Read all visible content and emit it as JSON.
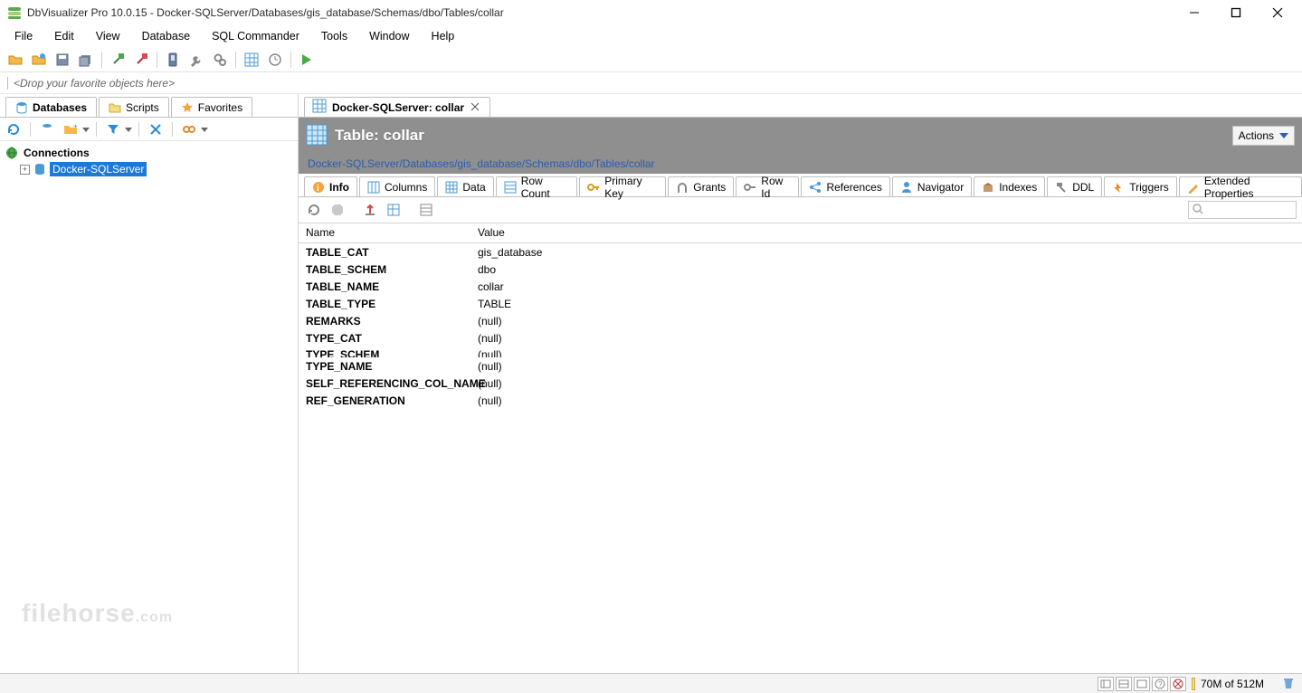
{
  "window": {
    "title": "DbVisualizer Pro 10.0.15 - Docker-SQLServer/Databases/gis_database/Schemas/dbo/Tables/collar"
  },
  "menubar": [
    "File",
    "Edit",
    "View",
    "Database",
    "SQL Commander",
    "Tools",
    "Window",
    "Help"
  ],
  "toolbar_icons": [
    "folder",
    "new-db",
    "save",
    "save-all",
    "connect",
    "disconnect",
    "device",
    "wrench",
    "gears",
    "grid",
    "clock",
    "run"
  ],
  "droparea": "<Drop your favorite objects here>",
  "left": {
    "tabs": [
      {
        "id": "databases",
        "label": "Databases",
        "active": true
      },
      {
        "id": "scripts",
        "label": "Scripts",
        "active": false
      },
      {
        "id": "favorites",
        "label": "Favorites",
        "active": false
      }
    ],
    "tree": {
      "root": "Connections",
      "items": [
        {
          "label": "Docker-SQLServer",
          "selected": true
        }
      ]
    }
  },
  "editor": {
    "tab_label": "Docker-SQLServer: collar"
  },
  "table_header": {
    "title": "Table: collar",
    "actions_label": "Actions"
  },
  "breadcrumb": "Docker-SQLServer/Databases/gis_database/Schemas/dbo/Tables/collar",
  "detail_tabs": [
    {
      "id": "info",
      "label": "Info",
      "active": true
    },
    {
      "id": "columns",
      "label": "Columns"
    },
    {
      "id": "data",
      "label": "Data"
    },
    {
      "id": "rowcount",
      "label": "Row Count"
    },
    {
      "id": "primarykey",
      "label": "Primary Key"
    },
    {
      "id": "grants",
      "label": "Grants"
    },
    {
      "id": "rowid",
      "label": "Row Id"
    },
    {
      "id": "references",
      "label": "References"
    },
    {
      "id": "navigator",
      "label": "Navigator"
    },
    {
      "id": "indexes",
      "label": "Indexes"
    },
    {
      "id": "ddl",
      "label": "DDL"
    },
    {
      "id": "triggers",
      "label": "Triggers"
    },
    {
      "id": "extprops",
      "label": "Extended Properties"
    }
  ],
  "info": {
    "columns": {
      "name": "Name",
      "value": "Value"
    },
    "rows": [
      {
        "name": "TABLE_CAT",
        "value": "gis_database"
      },
      {
        "name": "TABLE_SCHEM",
        "value": "dbo"
      },
      {
        "name": "TABLE_NAME",
        "value": "collar"
      },
      {
        "name": "TABLE_TYPE",
        "value": "TABLE"
      },
      {
        "name": "REMARKS",
        "value": "(null)"
      },
      {
        "name": "TYPE_CAT",
        "value": "(null)"
      },
      {
        "name": "TYPE_SCHEM",
        "value": "(null)",
        "cutoff": true
      },
      {
        "name": "TYPE_NAME",
        "value": "(null)"
      },
      {
        "name": "SELF_REFERENCING_COL_NAME",
        "value": "(null)"
      },
      {
        "name": "REF_GENERATION",
        "value": "(null)"
      }
    ]
  },
  "status": {
    "memory": "70M of 512M"
  },
  "watermark": "filehorse"
}
